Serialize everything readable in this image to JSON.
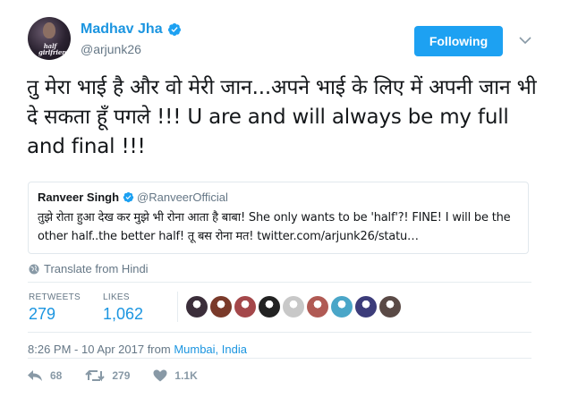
{
  "user": {
    "name": "Madhav Jha",
    "handle": "@arjunk26",
    "avatar_text": "half girlfriend"
  },
  "follow_button": {
    "label": "Following"
  },
  "tweet": {
    "text": "तु मेरा भाई है और वो मेरी जान...अपने भाई के लिए में अपनी जान भी दे सकता हूँ पगले !!! U are and will always be my full and final !!!"
  },
  "quoted": {
    "name": "Ranveer Singh",
    "handle": "@RanveerOfficial",
    "text": "तुझे रोता हुआ देख कर मुझे भी रोना आता है बाबा! She only wants to be 'half'?! FINE! I will be the other half..the better half! तू बस रोना मत! twitter.com/arjunk26/statu…"
  },
  "translate": {
    "label": "Translate from Hindi"
  },
  "stats": {
    "retweets_label": "RETWEETS",
    "retweets_value": "279",
    "likes_label": "LIKES",
    "likes_value": "1,062"
  },
  "likers": [
    {
      "icon": "avatar",
      "color": "#3b2e3a"
    },
    {
      "icon": "avatar",
      "color": "#7a3a2a"
    },
    {
      "icon": "avatar",
      "color": "#a4474a"
    },
    {
      "icon": "avatar",
      "color": "#222222"
    },
    {
      "icon": "avatar",
      "color": "#c8c8c8"
    },
    {
      "icon": "avatar",
      "color": "#b05a54"
    },
    {
      "icon": "avatar",
      "color": "#4aa6c8"
    },
    {
      "icon": "avatar",
      "color": "#3c3c7a"
    },
    {
      "icon": "avatar",
      "color": "#5a4a46"
    }
  ],
  "timestamp": {
    "time": "8:26 PM - 10 Apr 2017 from ",
    "location": "Mumbai, India"
  },
  "actions": {
    "reply_count": "68",
    "retweet_count": "279",
    "like_count": "1.1K"
  },
  "colors": {
    "accent": "#1da1f2",
    "link": "#1b95e0",
    "muted": "#657786"
  }
}
